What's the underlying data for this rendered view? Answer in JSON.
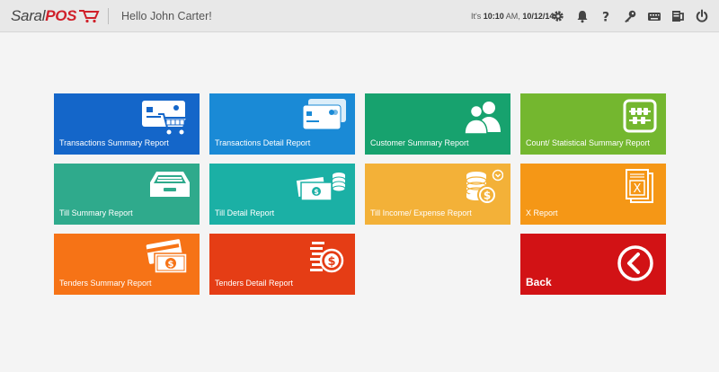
{
  "app": {
    "brand_a": "Saral",
    "brand_b": "POS"
  },
  "header": {
    "greeting": "Hello John Carter!",
    "time_prefix": "It's",
    "time": "10:10",
    "ampm": "AM,",
    "date": "10/12/14"
  },
  "toolbar_icons": [
    "settings-icon",
    "bell-icon",
    "help-icon",
    "key-icon",
    "keyboard-icon",
    "cash-drawer-icon",
    "power-icon"
  ],
  "tiles": [
    {
      "label": "Transactions Summary Report",
      "color": "#1466c9",
      "icon": "card-cart-icon"
    },
    {
      "label": "Transactions Detail Report",
      "color": "#1a8ad6",
      "icon": "cards-icon"
    },
    {
      "label": "Customer Summary Report",
      "color": "#17a26e",
      "icon": "users-icon"
    },
    {
      "label": "Count/ Statistical Summary Report",
      "color": "#74b72f",
      "icon": "abacus-icon"
    },
    {
      "label": "Till Summary Report",
      "color": "#2faa8c",
      "icon": "tray-icon"
    },
    {
      "label": "Till Detail Report",
      "color": "#1bb0a5",
      "icon": "cash-coins-icon"
    },
    {
      "label": "Till Income/ Expense Report",
      "color": "#f3b138",
      "icon": "coins-dollar-icon"
    },
    {
      "label": "X Report",
      "color": "#f59716",
      "icon": "x-report-icon"
    },
    {
      "label": "Tenders Summary Report",
      "color": "#f67316",
      "icon": "tender-cards-icon"
    },
    {
      "label": "Tenders Detail Report",
      "color": "#e53d15",
      "icon": "tender-coins-icon"
    },
    {
      "label": "Back",
      "color": "#d21215",
      "icon": "back-icon"
    }
  ]
}
